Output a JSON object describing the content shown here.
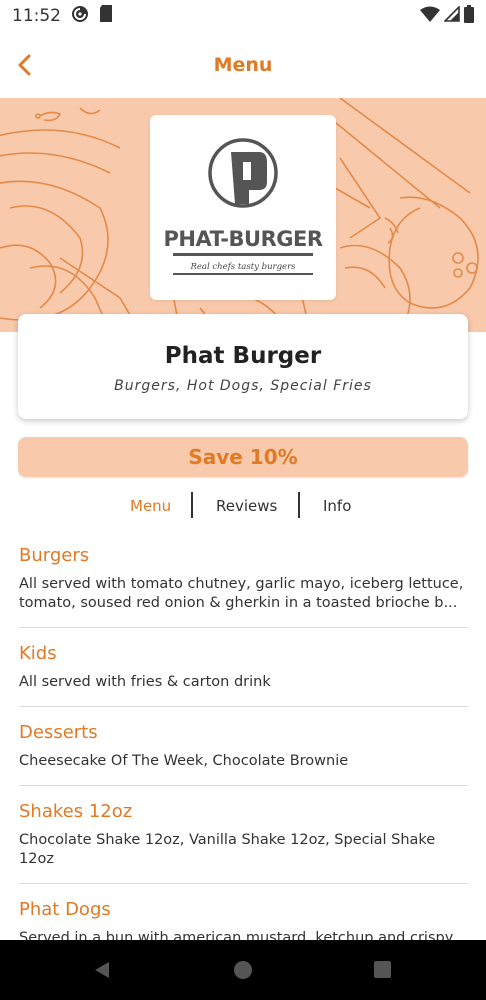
{
  "status_bar": {
    "time": "11:52",
    "icons": [
      "pocket-casts-icon",
      "sd-card-icon",
      "wifi-icon",
      "signal-icon",
      "battery-icon"
    ]
  },
  "app_bar": {
    "back_icon": "chevron-left-icon",
    "title": "Menu"
  },
  "restaurant": {
    "logo_text": "PHAT-BURGER",
    "logo_tagline": "Real chefs tasty burgers",
    "name": "Phat Burger",
    "tags": "Burgers, Hot Dogs, Special Fries"
  },
  "promo": {
    "label": "Save 10%"
  },
  "tabs": [
    {
      "label": "Menu",
      "active": true
    },
    {
      "label": "Reviews",
      "active": false
    },
    {
      "label": "Info",
      "active": false
    }
  ],
  "menu": [
    {
      "title": "Burgers",
      "description": "All served with tomato chutney, garlic mayo, iceberg lettuce, tomato, soused red onion & gherkin in a toasted brioche b..."
    },
    {
      "title": "Kids",
      "description": "All served with fries & carton drink"
    },
    {
      "title": "Desserts",
      "description": "Cheesecake Of The Week, Chocolate Brownie"
    },
    {
      "title": "Shakes 12oz",
      "description": "Chocolate Shake 12oz, Vanilla Shake 12oz, Special Shake 12oz"
    },
    {
      "title": "Phat Dogs",
      "description": "Served in a bun with american mustard, ketchup and crispy onions. To add any extras simply click 'Select Extras' in your"
    }
  ],
  "nav_bar": {
    "icons": [
      "back-triangle-icon",
      "home-circle-icon",
      "recents-square-icon"
    ]
  },
  "colors": {
    "accent": "#e07a25",
    "banner_bg": "#f8c9aa",
    "text_dark": "#222222"
  }
}
